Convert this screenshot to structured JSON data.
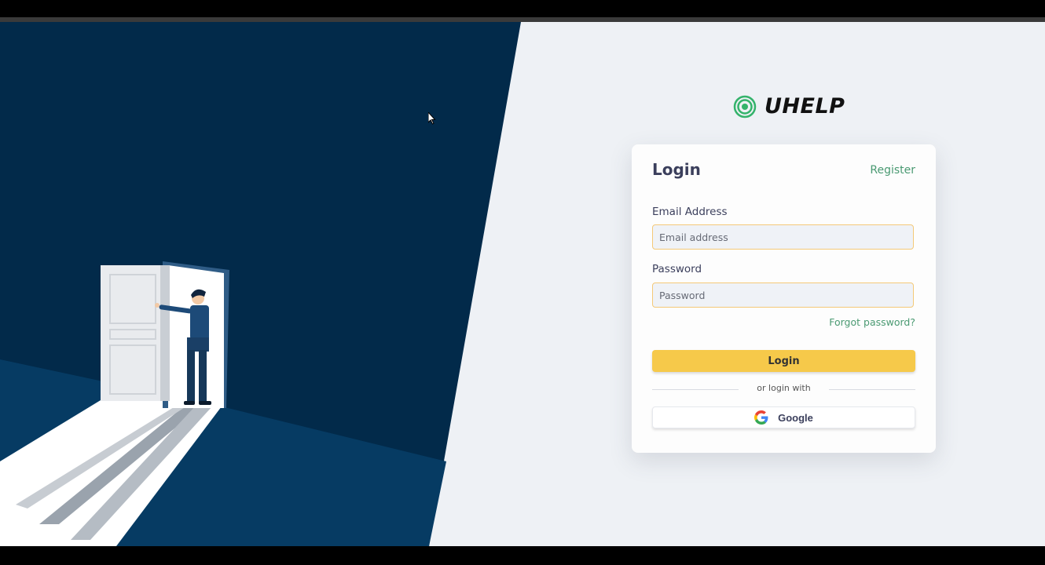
{
  "brand": {
    "name": "UHELP",
    "logo_icon": "target-icon",
    "logo_color": "#34b36b"
  },
  "login_card": {
    "title": "Login",
    "register_link": "Register",
    "email": {
      "label": "Email Address",
      "placeholder": "Email address",
      "value": ""
    },
    "password": {
      "label": "Password",
      "placeholder": "Password",
      "value": ""
    },
    "forgot_link": "Forgot password?",
    "login_button": "Login",
    "divider_text": "or login with",
    "google_button": {
      "label": "Google",
      "icon": "google-icon"
    }
  },
  "colors": {
    "hero_background": "#022a4a",
    "page_background": "#eef1f5",
    "accent_yellow": "#f6c94a",
    "link_green": "#4a9a72",
    "input_border": "#f4c978"
  }
}
